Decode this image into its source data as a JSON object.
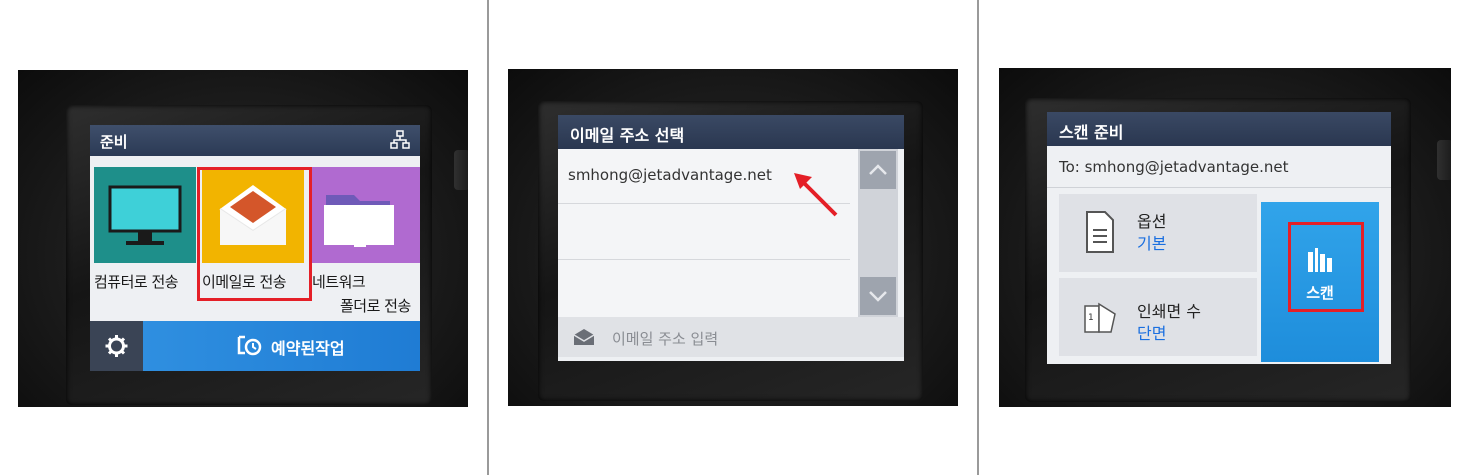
{
  "panel1": {
    "title": "준비",
    "icon_network": "network-icon",
    "tiles": [
      {
        "label": "컴퓨터로 전송",
        "icon": "monitor-icon",
        "color": "#1e8f8a"
      },
      {
        "label": "이메일로 전송",
        "icon": "email-icon",
        "color": "#f2b400"
      },
      {
        "label_line1": "네트워크",
        "label_line2": "폴더로 전송",
        "icon": "folder-icon",
        "color": "#b06ad0"
      }
    ],
    "bottom": {
      "settings_icon": "gear-icon",
      "jobs_icon": "scheduled-jobs-icon",
      "jobs_label": "예약된작업"
    }
  },
  "panel2": {
    "title": "이메일 주소 선택",
    "addresses": [
      "smhong@jetadvantage.net",
      "",
      ""
    ],
    "scroll_up_icon": "chevron-up-icon",
    "scroll_down_icon": "chevron-down-icon",
    "input_placeholder": "이메일 주소 입력",
    "input_icon": "envelope-icon"
  },
  "panel3": {
    "title": "스캔 준비",
    "to_line": "To: smhong@jetadvantage.net",
    "options": {
      "label": "옵션",
      "value": "기본",
      "icon": "document-icon"
    },
    "copies": {
      "label": "인쇄면 수",
      "value": "단면",
      "icon": "sides-icon"
    },
    "scan_button": {
      "label": "스캔",
      "icon": "scan-icon"
    }
  },
  "colors": {
    "highlight": "#e41f27",
    "accent_blue": "#1f7cd4",
    "link_blue": "#1a6fe0"
  }
}
